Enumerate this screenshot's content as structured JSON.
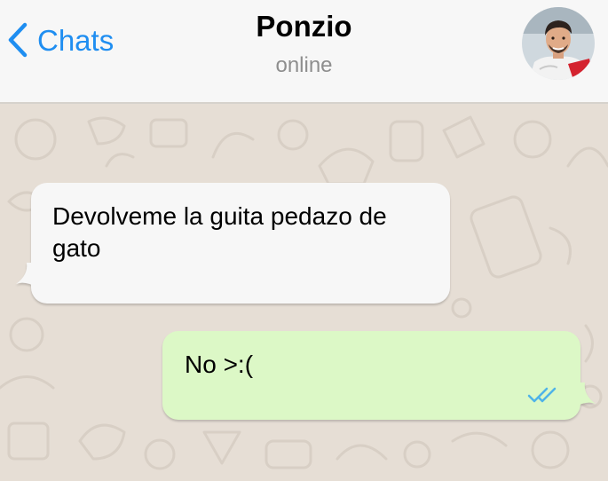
{
  "header": {
    "back_label": "Chats",
    "contact_name": "Ponzio",
    "status": "online"
  },
  "messages": [
    {
      "direction": "incoming",
      "text": "Devolveme la guita pedazo de gato"
    },
    {
      "direction": "outgoing",
      "text": "No >:(",
      "read_receipt": "double-check-blue"
    }
  ],
  "colors": {
    "accent": "#1f8ef1",
    "incoming_bubble": "#f7f7f7",
    "outgoing_bubble": "#dcf8c6",
    "read_ticks": "#4fb3e8"
  }
}
